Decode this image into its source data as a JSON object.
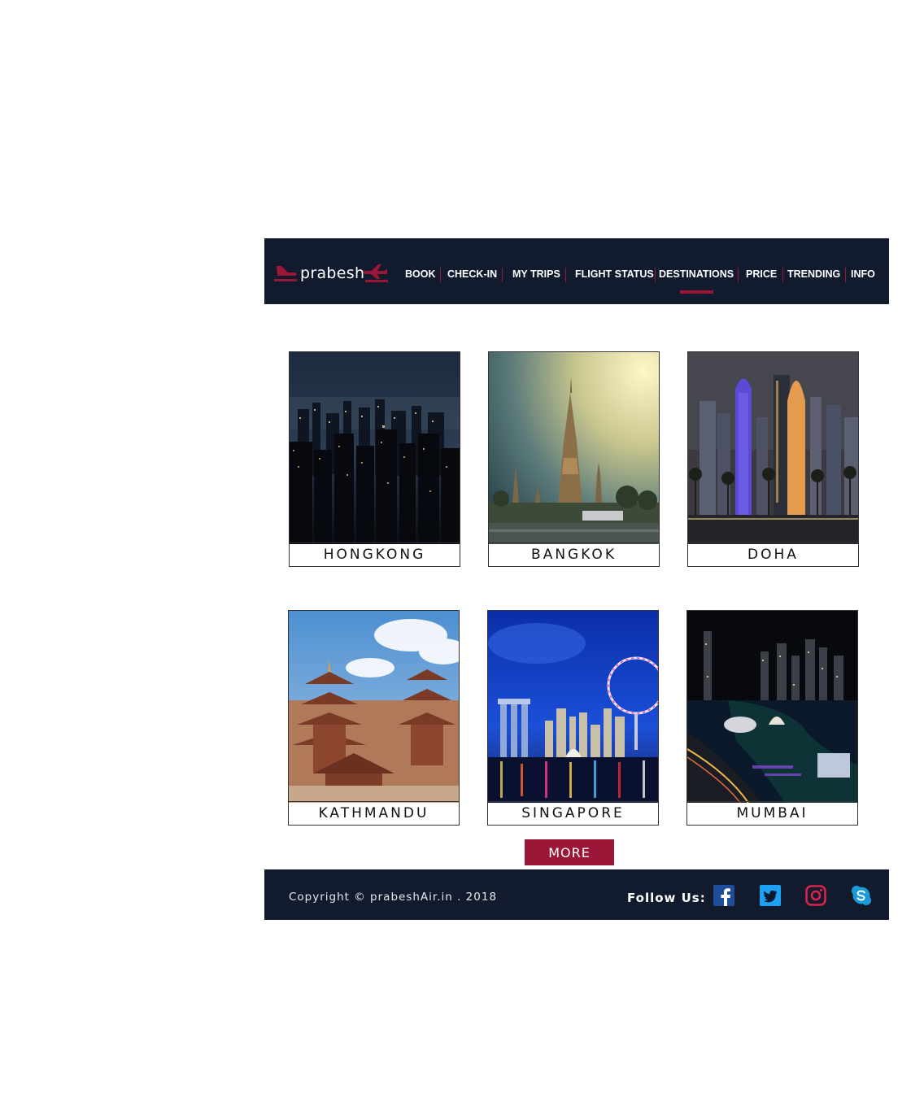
{
  "brand": {
    "name": "prabesh",
    "accent_color": "#9b1737",
    "nav_bg": "#121a2e"
  },
  "nav": {
    "items": [
      {
        "label": "BOOK"
      },
      {
        "label": "CHECK-IN"
      },
      {
        "label": "MY TRIPS"
      },
      {
        "label": "FLIGHT STATUS"
      },
      {
        "label": "DESTINATIONS",
        "active": true
      },
      {
        "label": "PRICE"
      },
      {
        "label": "TRENDING"
      },
      {
        "label": "INFO"
      }
    ]
  },
  "destinations": [
    {
      "name": "HONGKONG",
      "image": "hongkong-night-skyline"
    },
    {
      "name": "BANGKOK",
      "image": "bangkok-temple"
    },
    {
      "name": "DOHA",
      "image": "doha-towers"
    },
    {
      "name": "KATHMANDU",
      "image": "kathmandu-pagodas"
    },
    {
      "name": "SINGAPORE",
      "image": "singapore-marina"
    },
    {
      "name": "MUMBAI",
      "image": "city-night-harbor"
    }
  ],
  "more_button": "MORE",
  "footer": {
    "copyright": "Copyright © prabeshAir.in . 2018",
    "follow_label": "Follow Us:",
    "social": [
      {
        "icon": "facebook-icon",
        "color": "#1d4e9a"
      },
      {
        "icon": "twitter-icon",
        "color": "#1da1f2"
      },
      {
        "icon": "instagram-icon",
        "color": "#d9234b"
      },
      {
        "icon": "skype-icon",
        "color": "#1a9bd8"
      }
    ]
  }
}
